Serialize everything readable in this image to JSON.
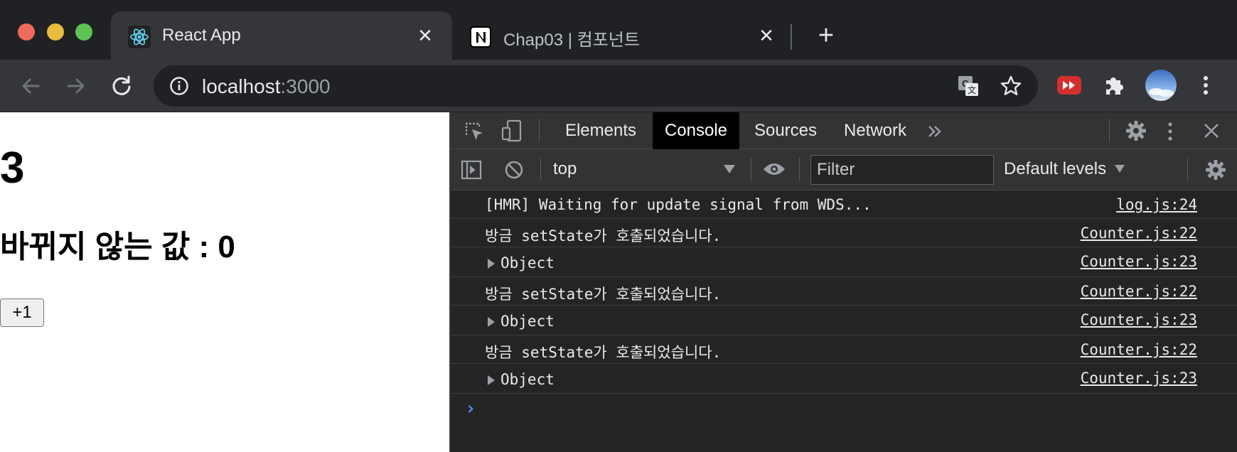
{
  "browser": {
    "tabs": [
      {
        "title": "React App",
        "favicon": "react-logo-icon",
        "active": true
      },
      {
        "title": "Chap03 | 컴포넌트",
        "favicon": "notion-logo-icon",
        "active": false
      }
    ],
    "address": {
      "host": "localhost",
      "port": ":3000"
    }
  },
  "page": {
    "count": "3",
    "static_value_text": "바뀌지 않는 값 : 0",
    "increment_label": "+1"
  },
  "devtools": {
    "tabs": [
      "Elements",
      "Console",
      "Sources",
      "Network"
    ],
    "active_tab": "Console",
    "context": "top",
    "filter_placeholder": "Filter",
    "levels": "Default levels",
    "logs": [
      {
        "message": "[HMR] Waiting for update signal from WDS...",
        "source": "log.js:24",
        "expandable": false
      },
      {
        "message": "방금 setState가 호출되었습니다.",
        "source": "Counter.js:22",
        "expandable": false
      },
      {
        "message": "Object",
        "source": "Counter.js:23",
        "expandable": true
      },
      {
        "message": "방금 setState가 호출되었습니다.",
        "source": "Counter.js:22",
        "expandable": false
      },
      {
        "message": "Object",
        "source": "Counter.js:23",
        "expandable": true
      },
      {
        "message": "방금 setState가 호출되었습니다.",
        "source": "Counter.js:22",
        "expandable": false
      },
      {
        "message": "Object",
        "source": "Counter.js:23",
        "expandable": true
      }
    ]
  },
  "colors": {
    "accent_blue": "#4d90fe",
    "traffic_red": "#ed6a5e",
    "traffic_yellow": "#e6bd3e",
    "traffic_green": "#5fc454"
  }
}
